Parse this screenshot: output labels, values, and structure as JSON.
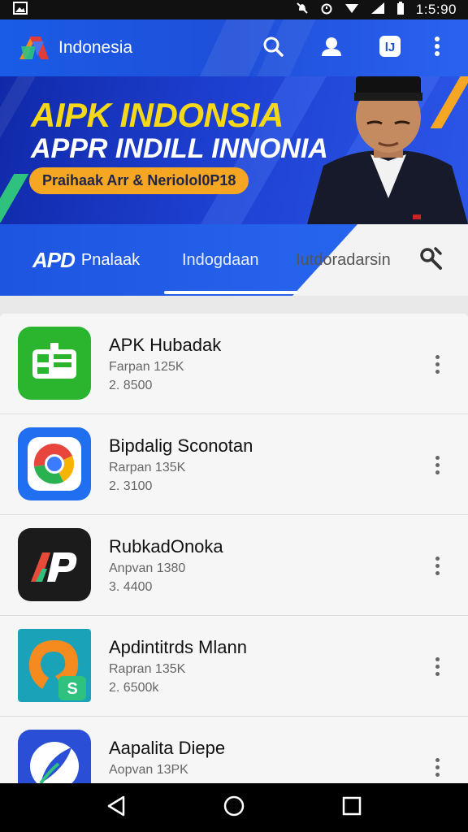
{
  "status_bar": {
    "time": "1:5:90",
    "icons": [
      "image-icon",
      "bell-off-icon",
      "alarm-icon",
      "wifi-icon",
      "signal-icon",
      "battery-icon"
    ]
  },
  "app_bar": {
    "title": "Indonesia",
    "actions": [
      "search-icon",
      "profile-icon",
      "translate-icon",
      "more-vert-icon"
    ]
  },
  "banner": {
    "title_line1": "AIPK INDONSIA",
    "title_line2": "APPR INDILL INNONIA",
    "pill": "Praihaak Arr & Neriolol0P18",
    "colors": {
      "title1": "#f5d81a",
      "pill": "#f5a623",
      "bg": "#1d3fd0"
    }
  },
  "tabs": {
    "items": [
      {
        "mark": "APD",
        "label": "Pnalaak"
      },
      {
        "label": "Indogdaan"
      },
      {
        "label": "Iutdoradarsin"
      }
    ],
    "selected_index": 1,
    "tool_icon": "settings-tool-icon"
  },
  "apps": [
    {
      "title": "APK Hubadak",
      "subtitle": "Farpan 125K",
      "size": "2. 8500",
      "icon": "green-app-icon"
    },
    {
      "title": "Bipdalig Sconotan",
      "subtitle": "Rarpan 135K",
      "size": "2. 3100",
      "icon": "chrome-like-app-icon"
    },
    {
      "title": "RubkadOnoka",
      "subtitle": "Anpvan 1380",
      "size": "3. 4400",
      "icon": "ap-dark-app-icon"
    },
    {
      "title": "Apdintitrds Mlann",
      "subtitle": "Rapran 135K",
      "size": "2. 6500k",
      "icon": "orange-swirl-app-icon"
    },
    {
      "title": "Aapalita Diepe",
      "subtitle": "Aopvan 13PK",
      "size": "",
      "icon": "blue-feather-app-icon"
    }
  ],
  "nav_bar": [
    "back-icon",
    "home-icon",
    "recents-icon"
  ]
}
